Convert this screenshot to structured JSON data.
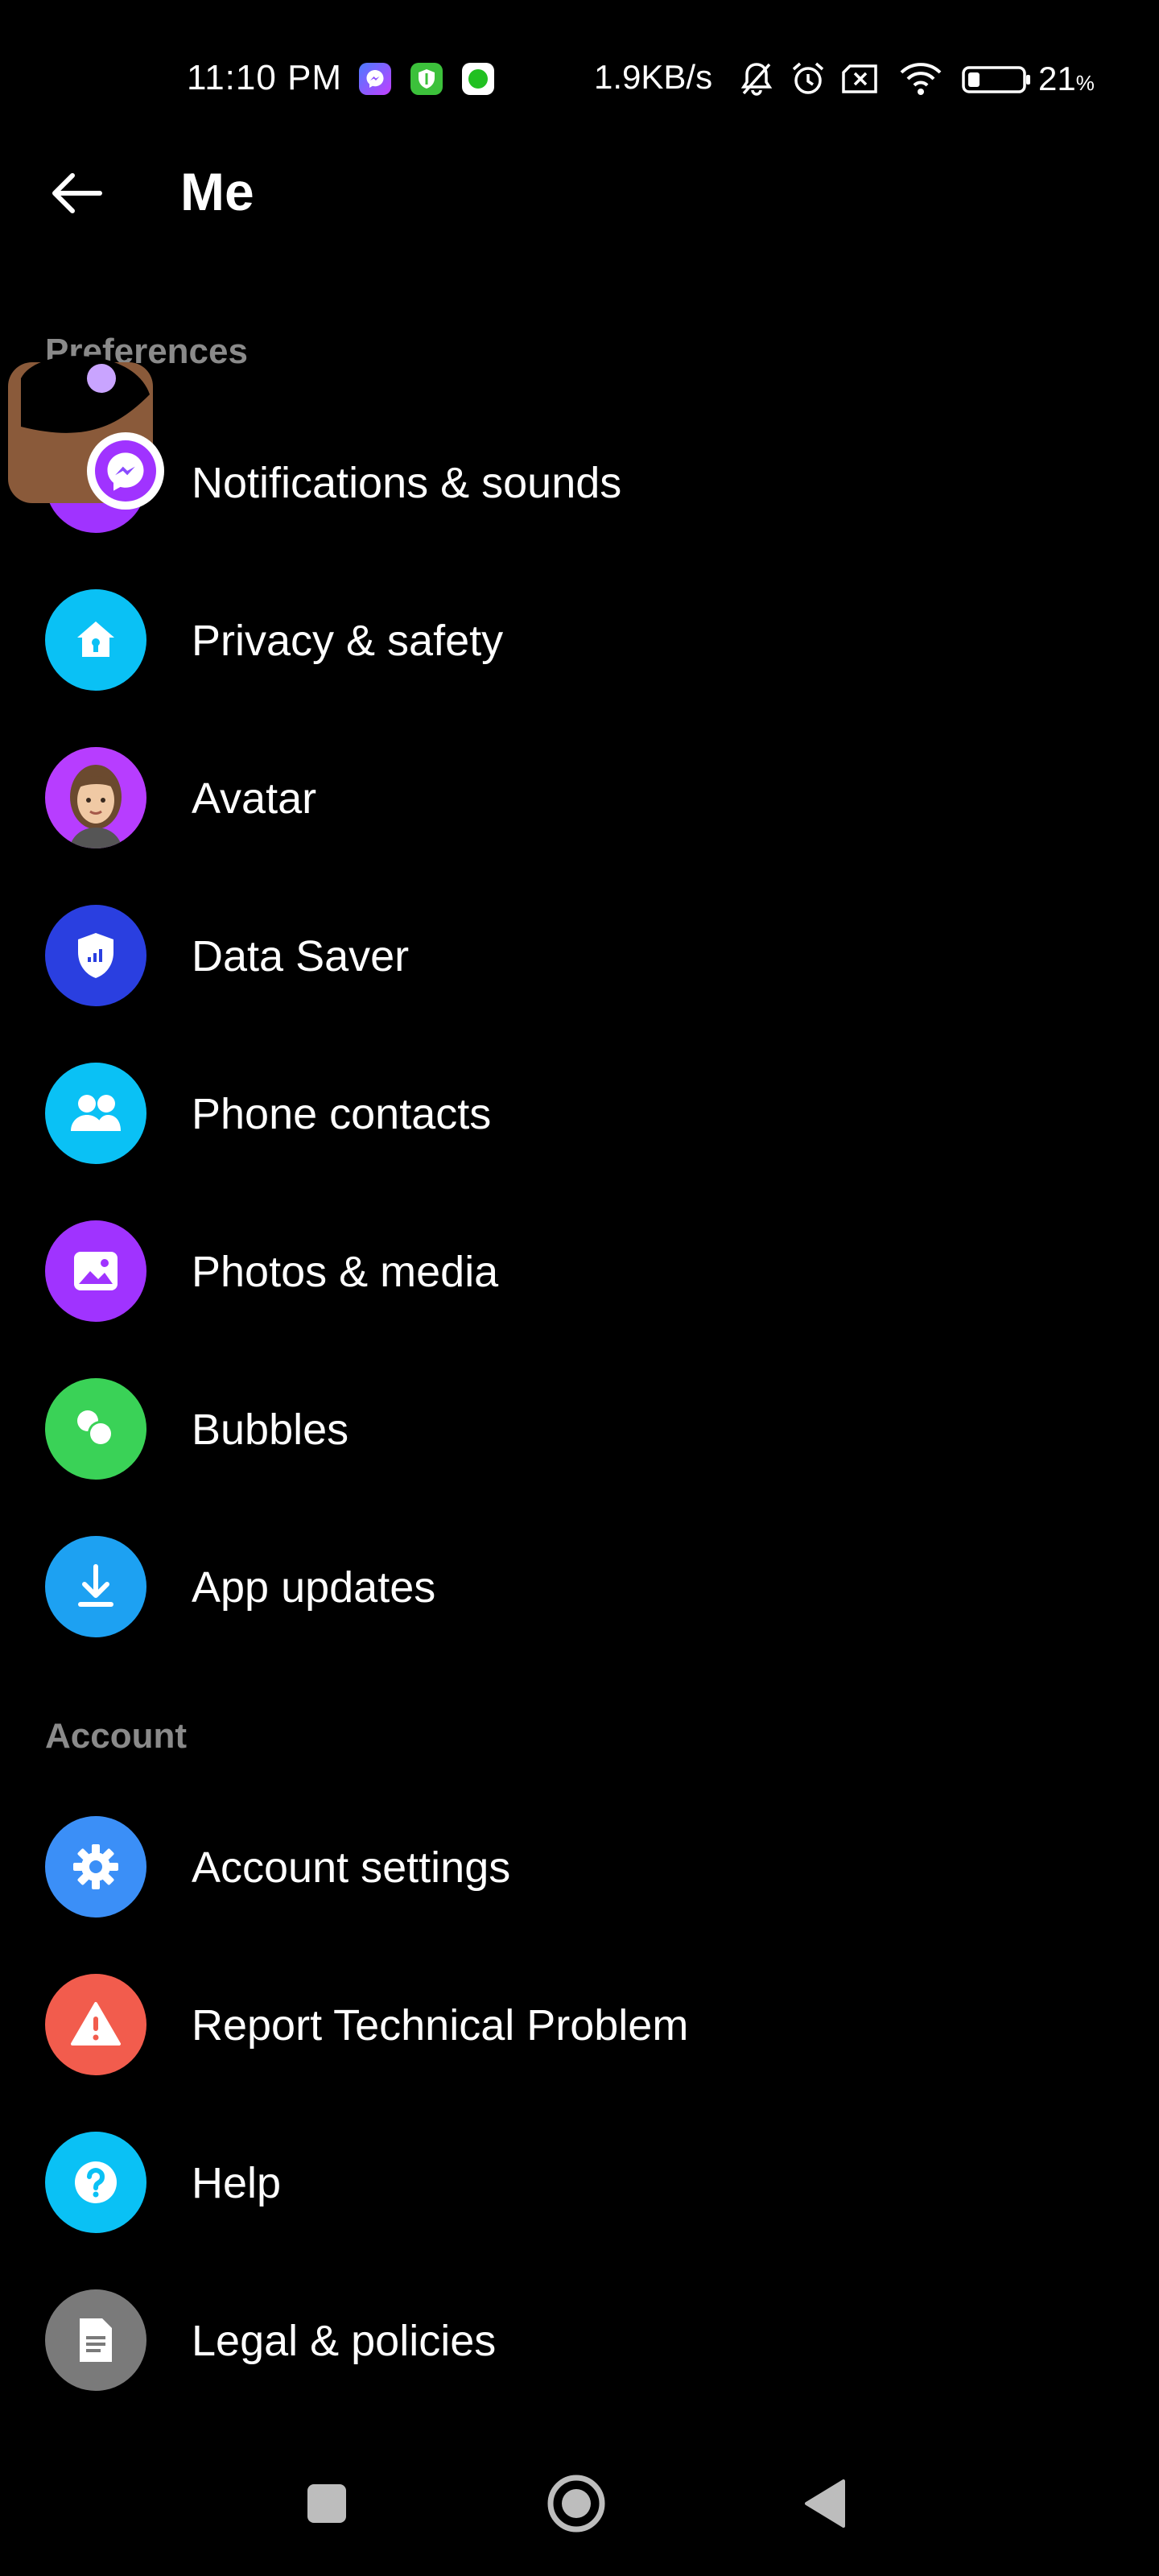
{
  "status_bar": {
    "time": "11:10 PM",
    "network_speed": "1.9KB/s",
    "battery_percent": "21",
    "battery_unit": "%",
    "icons": [
      "messenger-icon",
      "vpn-shield-icon",
      "green-app-icon",
      "bell-muted-icon",
      "alarm-icon",
      "sim-off-icon",
      "wifi-icon",
      "battery-icon"
    ]
  },
  "header": {
    "title": "Me",
    "back_icon": "arrow-left-icon"
  },
  "sections": {
    "preferences": {
      "title": "Preferences",
      "items": [
        {
          "label": "Notifications & sounds",
          "icon": "bell-icon",
          "color": "#a033ff"
        },
        {
          "label": "Privacy & safety",
          "icon": "house-lock-icon",
          "color": "#0ac1f5"
        },
        {
          "label": "Avatar",
          "icon": "avatar-face-icon",
          "color": "#b73dff"
        },
        {
          "label": "Data Saver",
          "icon": "shield-signal-icon",
          "color": "#2a3fe0"
        },
        {
          "label": "Phone contacts",
          "icon": "people-icon",
          "color": "#0ac1f5"
        },
        {
          "label": "Photos & media",
          "icon": "image-icon",
          "color": "#a033ff"
        },
        {
          "label": "Bubbles",
          "icon": "bubbles-icon",
          "color": "#3ad257"
        },
        {
          "label": "App updates",
          "icon": "download-icon",
          "color": "#1da1f2"
        }
      ]
    },
    "account": {
      "title": "Account",
      "items": [
        {
          "label": "Account settings",
          "icon": "gear-icon",
          "color": "#3b8ff7"
        },
        {
          "label": "Report Technical Problem",
          "icon": "warning-icon",
          "color": "#f25c4d"
        },
        {
          "label": "Help",
          "icon": "question-icon",
          "color": "#0ac1f5"
        },
        {
          "label": "Legal & policies",
          "icon": "document-icon",
          "color": "#7a7a7a"
        }
      ]
    }
  },
  "nav": {
    "recents_icon": "square-icon",
    "home_icon": "circle-icon",
    "back_icon": "triangle-back-icon"
  }
}
